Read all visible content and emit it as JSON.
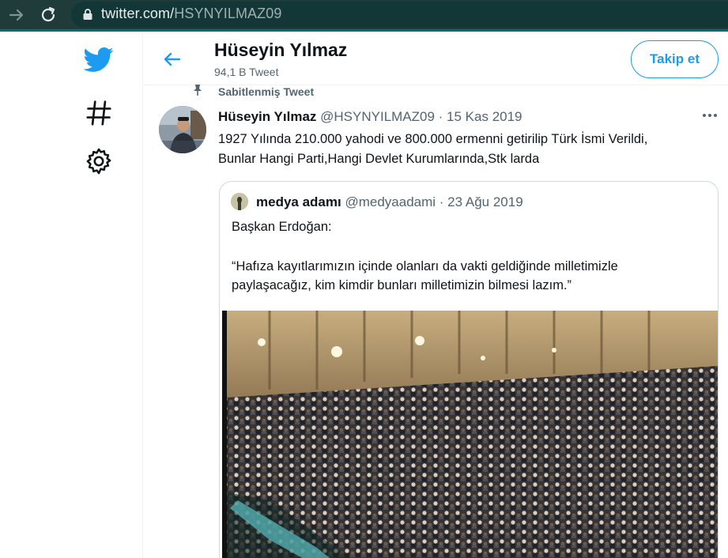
{
  "browser": {
    "url_domain": "twitter.com/",
    "url_path": "HSYNYILMAZ09"
  },
  "sidebar": {
    "items": [
      {
        "icon": "twitter-bird-icon"
      },
      {
        "icon": "hashtag-icon"
      },
      {
        "icon": "gear-icon"
      }
    ]
  },
  "header": {
    "name": "Hüseyin Yılmaz",
    "tweet_count": "94,1 B Tweet",
    "follow_label": "Takip et"
  },
  "pinned": {
    "label": "Sabitlenmiş Tweet",
    "author_name": "Hüseyin Yılmaz",
    "author_meta": "@HSYNYILMAZ09 · 15 Kas 2019",
    "text_line_1": "1927 Yılında 210.000 yahodi ve 800.000 ermenni getirilip Türk İsmi Verildi,",
    "text_line_2": "Bunlar Hangi Parti,Hangi Devlet Kurumlarında,Stk larda"
  },
  "quote": {
    "author_name": "medya adamı",
    "author_meta": "@medyaadami · 23 Ağu 2019",
    "line_1": "Başkan Erdoğan:",
    "line_2": "“Hafıza kayıtlarımızın içinde olanları da vakti geldiğinde milletimizle",
    "line_3": "paylaşacağız, kim kimdir bunları milletimizin bilmesi lazım.”"
  },
  "colors": {
    "accent": "#1d9bf0",
    "browser_bar": "#1f3b3a",
    "text_secondary": "#536471"
  }
}
